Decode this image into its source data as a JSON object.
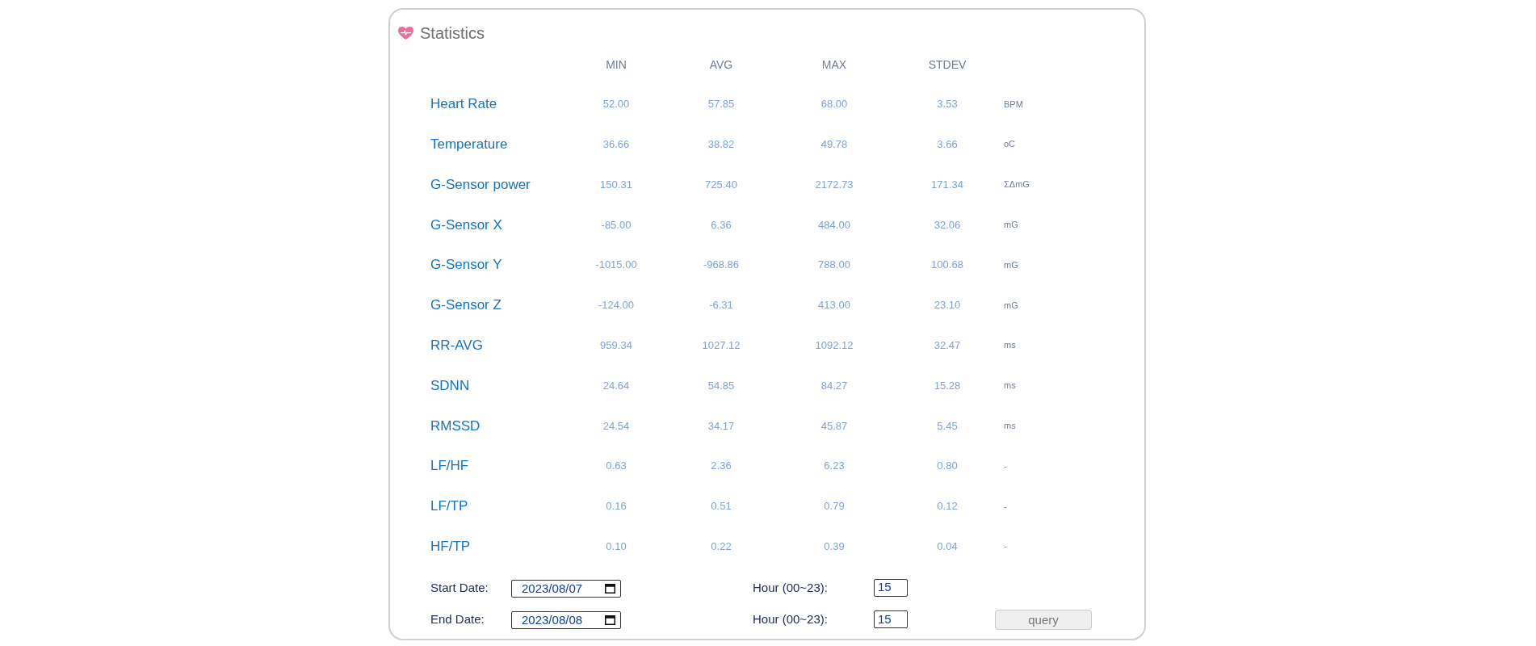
{
  "panel": {
    "title": "Statistics"
  },
  "columns": [
    "MIN",
    "AVG",
    "MAX",
    "STDEV"
  ],
  "rows": [
    {
      "label": "Heart Rate",
      "values": [
        "52.00",
        "57.85",
        "68.00",
        "3.53"
      ],
      "unit": "BPM"
    },
    {
      "label": "Temperature",
      "values": [
        "36.66",
        "38.82",
        "49.78",
        "3.66"
      ],
      "unit": "oC"
    },
    {
      "label": "G-Sensor power",
      "values": [
        "150.31",
        "725.40",
        "2172.73",
        "171.34"
      ],
      "unit": "ΣΔmG"
    },
    {
      "label": "G-Sensor X",
      "values": [
        "-85.00",
        "6.36",
        "484.00",
        "32.06"
      ],
      "unit": "mG"
    },
    {
      "label": "G-Sensor Y",
      "values": [
        "-1015.00",
        "-968.86",
        "788.00",
        "100.68"
      ],
      "unit": "mG"
    },
    {
      "label": "G-Sensor Z",
      "values": [
        "-124.00",
        "-6.31",
        "413.00",
        "23.10"
      ],
      "unit": "mG"
    },
    {
      "label": "RR-AVG",
      "values": [
        "959.34",
        "1027.12",
        "1092.12",
        "32.47"
      ],
      "unit": "ms"
    },
    {
      "label": "SDNN",
      "values": [
        "24.64",
        "54.85",
        "84.27",
        "15.28"
      ],
      "unit": "ms"
    },
    {
      "label": "RMSSD",
      "values": [
        "24.54",
        "34.17",
        "45.87",
        "5.45"
      ],
      "unit": "ms"
    },
    {
      "label": "LF/HF",
      "values": [
        "0.63",
        "2.36",
        "6.23",
        "0.80"
      ],
      "unit": "-"
    },
    {
      "label": "LF/TP",
      "values": [
        "0.16",
        "0.51",
        "0.79",
        "0.12"
      ],
      "unit": "-"
    },
    {
      "label": "HF/TP",
      "values": [
        "0.10",
        "0.22",
        "0.39",
        "0.04"
      ],
      "unit": "-"
    }
  ],
  "form": [
    {
      "date_label": "Start Date:",
      "date": "2023/08/07",
      "hour_label": "Hour (00~23):",
      "hour": "15"
    },
    {
      "date_label": "End Date:",
      "date": "2023/08/08",
      "hour_label": "Hour (00~23):",
      "hour": "15",
      "button": "query"
    }
  ]
}
